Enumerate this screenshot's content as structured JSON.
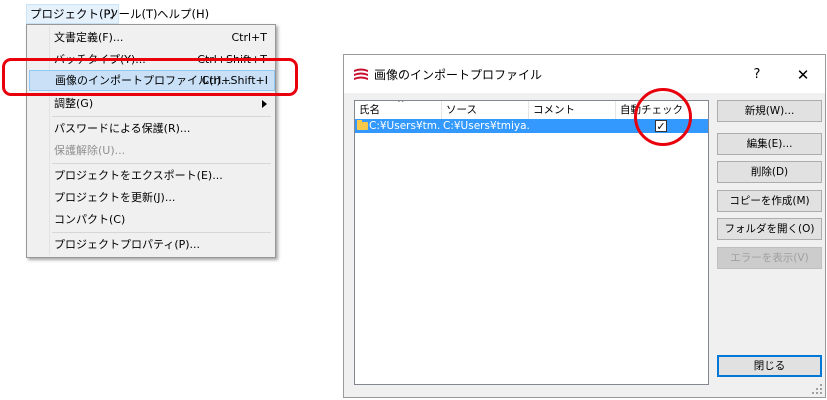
{
  "menubar": {
    "items": [
      "プロジェクト(P)",
      "ツール(T)",
      "ヘルプ(H)"
    ]
  },
  "dropdown": {
    "items": [
      {
        "label": "文書定義(F)...",
        "shortcut": "Ctrl+T"
      },
      {
        "label": "バッチタイプ(Y)...",
        "shortcut": "Ctrl+Shift+T"
      },
      {
        "label": "画像のインポートプロファイル(I)...",
        "shortcut": "Ctrl+Shift+I"
      },
      {
        "label": "調整(G)",
        "shortcut": ""
      },
      {
        "label": "パスワードによる保護(R)...",
        "shortcut": ""
      },
      {
        "label": "保護解除(U)...",
        "shortcut": ""
      },
      {
        "label": "プロジェクトをエクスポート(E)...",
        "shortcut": ""
      },
      {
        "label": "プロジェクトを更新(J)...",
        "shortcut": ""
      },
      {
        "label": "コンパクト(C)",
        "shortcut": ""
      },
      {
        "label": "プロジェクトプロパティ(P)...",
        "shortcut": ""
      }
    ]
  },
  "dialog": {
    "title": "画像のインポートプロファイル",
    "help": "?",
    "close": "✕",
    "columns": [
      "氏名",
      "ソース",
      "コメント",
      "自動チェック"
    ],
    "rows": [
      {
        "name": "C:¥Users¥tm...",
        "source": "C:¥Users¥tmiya...",
        "comment": "",
        "auto_check": "✓"
      }
    ],
    "buttons": {
      "new": "新規(W)...",
      "edit": "編集(E)...",
      "delete": "削除(D)",
      "copy": "コピーを作成(M)",
      "open_folder": "フォルダを開く(O)",
      "show_errors": "エラーを表示(V)",
      "close": "閉じる"
    }
  },
  "colors": {
    "highlight_annotation": "#e8000d",
    "selection": "#3399ff",
    "menu_highlight": "#c9e0f7"
  }
}
